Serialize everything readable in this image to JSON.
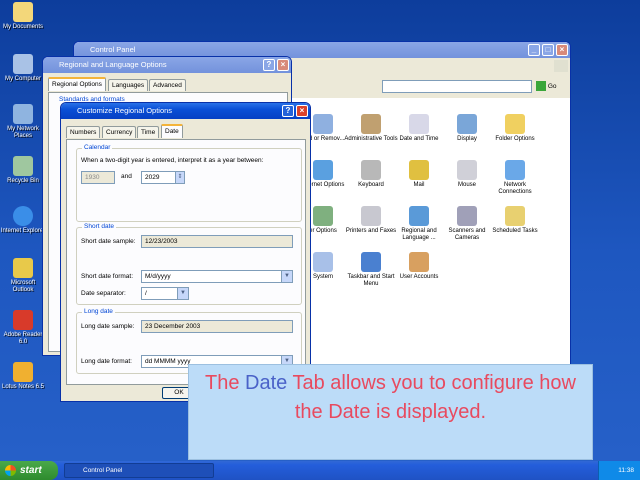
{
  "desktop_icons": [
    {
      "label": "My Documents",
      "icon": "folder-docs-icon"
    },
    {
      "label": "My Computer",
      "icon": "computer-icon"
    },
    {
      "label": "My Network Places",
      "icon": "network-icon"
    },
    {
      "label": "Recycle Bin",
      "icon": "recycle-bin-icon"
    },
    {
      "label": "Internet Explorer",
      "icon": "ie-icon"
    },
    {
      "label": "Microsoft Outlook",
      "icon": "outlook-icon"
    },
    {
      "label": "Adobe Reader 6.0",
      "icon": "adobe-reader-icon"
    },
    {
      "label": "Lotus Notes 6.5",
      "icon": "lotus-notes-icon"
    }
  ],
  "control_panel": {
    "title": "Control Panel",
    "go_label": "Go",
    "items": [
      {
        "label": "Add or Remov...",
        "icon": "add-remove-icon"
      },
      {
        "label": "Administrative Tools",
        "icon": "admin-tools-icon"
      },
      {
        "label": "Date and Time",
        "icon": "clock-icon"
      },
      {
        "label": "Display",
        "icon": "display-icon"
      },
      {
        "label": "Folder Options",
        "icon": "folder-options-icon"
      },
      {
        "label": "Internet Options",
        "icon": "globe-icon"
      },
      {
        "label": "Keyboard",
        "icon": "keyboard-icon"
      },
      {
        "label": "Mail",
        "icon": "mail-icon"
      },
      {
        "label": "Mouse",
        "icon": "mouse-icon"
      },
      {
        "label": "Network Connections",
        "icon": "network-connections-icon"
      },
      {
        "label": "er Options",
        "icon": "power-options-icon"
      },
      {
        "label": "Printers and Faxes",
        "icon": "printer-icon"
      },
      {
        "label": "Regional and Language ...",
        "icon": "regional-icon"
      },
      {
        "label": "Scanners and Cameras",
        "icon": "scanner-icon"
      },
      {
        "label": "Scheduled Tasks",
        "icon": "scheduled-tasks-icon"
      },
      {
        "label": "System",
        "icon": "system-icon"
      },
      {
        "label": "Taskbar and Start Menu",
        "icon": "taskbar-icon"
      },
      {
        "label": "User Accounts",
        "icon": "users-icon"
      }
    ]
  },
  "regional": {
    "title": "Regional and Language Options",
    "tabs": [
      "Regional Options",
      "Languages",
      "Advanced"
    ],
    "group_label": "Standards and formats"
  },
  "customize": {
    "title": "Customize Regional Options",
    "tabs": [
      "Numbers",
      "Currency",
      "Time",
      "Date"
    ],
    "selected_tab": "Date",
    "calendar": {
      "legend": "Calendar",
      "description": "When a two-digit year is entered, interpret it as a year between:",
      "from_year": "1930",
      "and_label": "and",
      "to_year": "2029"
    },
    "short_date": {
      "legend": "Short date",
      "sample_label": "Short date sample:",
      "sample_value": "12/23/2003",
      "format_label": "Short date format:",
      "format_value": "M/d/yyyy",
      "separator_label": "Date separator:",
      "separator_value": "/"
    },
    "long_date": {
      "legend": "Long date",
      "sample_label": "Long date sample:",
      "sample_value": "23 December 2003",
      "format_label": "Long date format:",
      "format_value": "dd MMMM yyyy"
    },
    "ok_label": "OK"
  },
  "taskbar": {
    "start_label": "start",
    "item_label": "Control Panel",
    "clock": "11:38"
  },
  "caption": {
    "before": "The ",
    "highlight": "Date",
    "after": " Tab allows you to configure how the Date is displayed."
  }
}
